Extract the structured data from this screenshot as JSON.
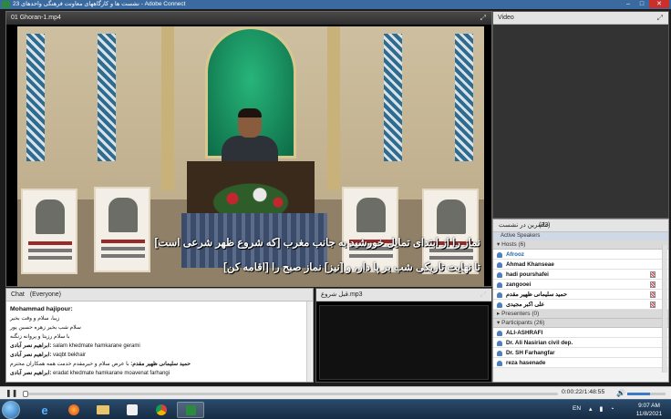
{
  "window": {
    "title": "23 نشست ها و کارگاههای معاونت فرهنگی واحدهای - Adobe Connect"
  },
  "video_pod": {
    "title": "01 Ghoran-1.mp4",
    "subtitle_line1": "نماز را از ابتدای تمایل خورشید به جانب مغرب [که شروع ظهر شرعی است]",
    "subtitle_line2": "تا نهایت تاریکی شب بر پا دار، و [نیز] نماز صبح را [اقامه کن]"
  },
  "side_video": {
    "title": "Video"
  },
  "attendees": {
    "title": "حاضرین در نشست",
    "count": "(32)",
    "active_speakers": "Active Speakers",
    "hosts_label": "Hosts (6)",
    "hosts": [
      "Afrooz",
      "Ahmad Khanseae",
      "hadi pourshafei",
      "zangooei",
      "حمید سلیمانی ظهیر مقدم",
      "علی اکبر مجیدی"
    ],
    "presenters_label": "Presenters (0)",
    "participants_label": "Participants (26)",
    "participants": [
      "ALI-ASHRAFI",
      "Dr. Ali Nasirian civil dep.",
      "Dr. SH Farhangfar",
      "reza hasenade"
    ]
  },
  "chat": {
    "title": "Chat",
    "scope": "(Everyone)",
    "messages": [
      {
        "sender": "Mohammad hajipour:",
        "text": "زیبا، سلام و وقت بخیر"
      },
      {
        "sender": "",
        "text": "سلام شب بخیر زهره حسین پور"
      },
      {
        "sender": "",
        "text": "با سلام رزیتا و پروانه زنگنه"
      },
      {
        "sender": "ابراهیم نصر آبادی:",
        "text": "salam khedmate hamkarane gerami"
      },
      {
        "sender": "ابراهیم نصر آبادی:",
        "text": "vaqbt bekhair"
      },
      {
        "sender": "حمید سلیمانی ظهیر مقدم:",
        "text": "با عرض سلام و خیرمقدم خدمت همه همکاران محترم"
      },
      {
        "sender": "ابراهیم نصر آبادی:",
        "text": "eradat khedmate hamkarane moavenat farhangi"
      }
    ]
  },
  "mp3_pod": {
    "title": "قبل شروع.mp3"
  },
  "player": {
    "progress_fraction": 0.003,
    "time": "0:00:22/1:48:55",
    "volume_fraction": 0.6
  },
  "taskbar": {
    "lang": "EN",
    "clock_time": "9:07 AM",
    "clock_date": "11/8/2021",
    "apps": [
      "start-button",
      "ie-icon",
      "firefox-icon",
      "explorer-icon",
      "media-player-icon",
      "chrome-icon",
      "adobe-connect-icon"
    ]
  }
}
